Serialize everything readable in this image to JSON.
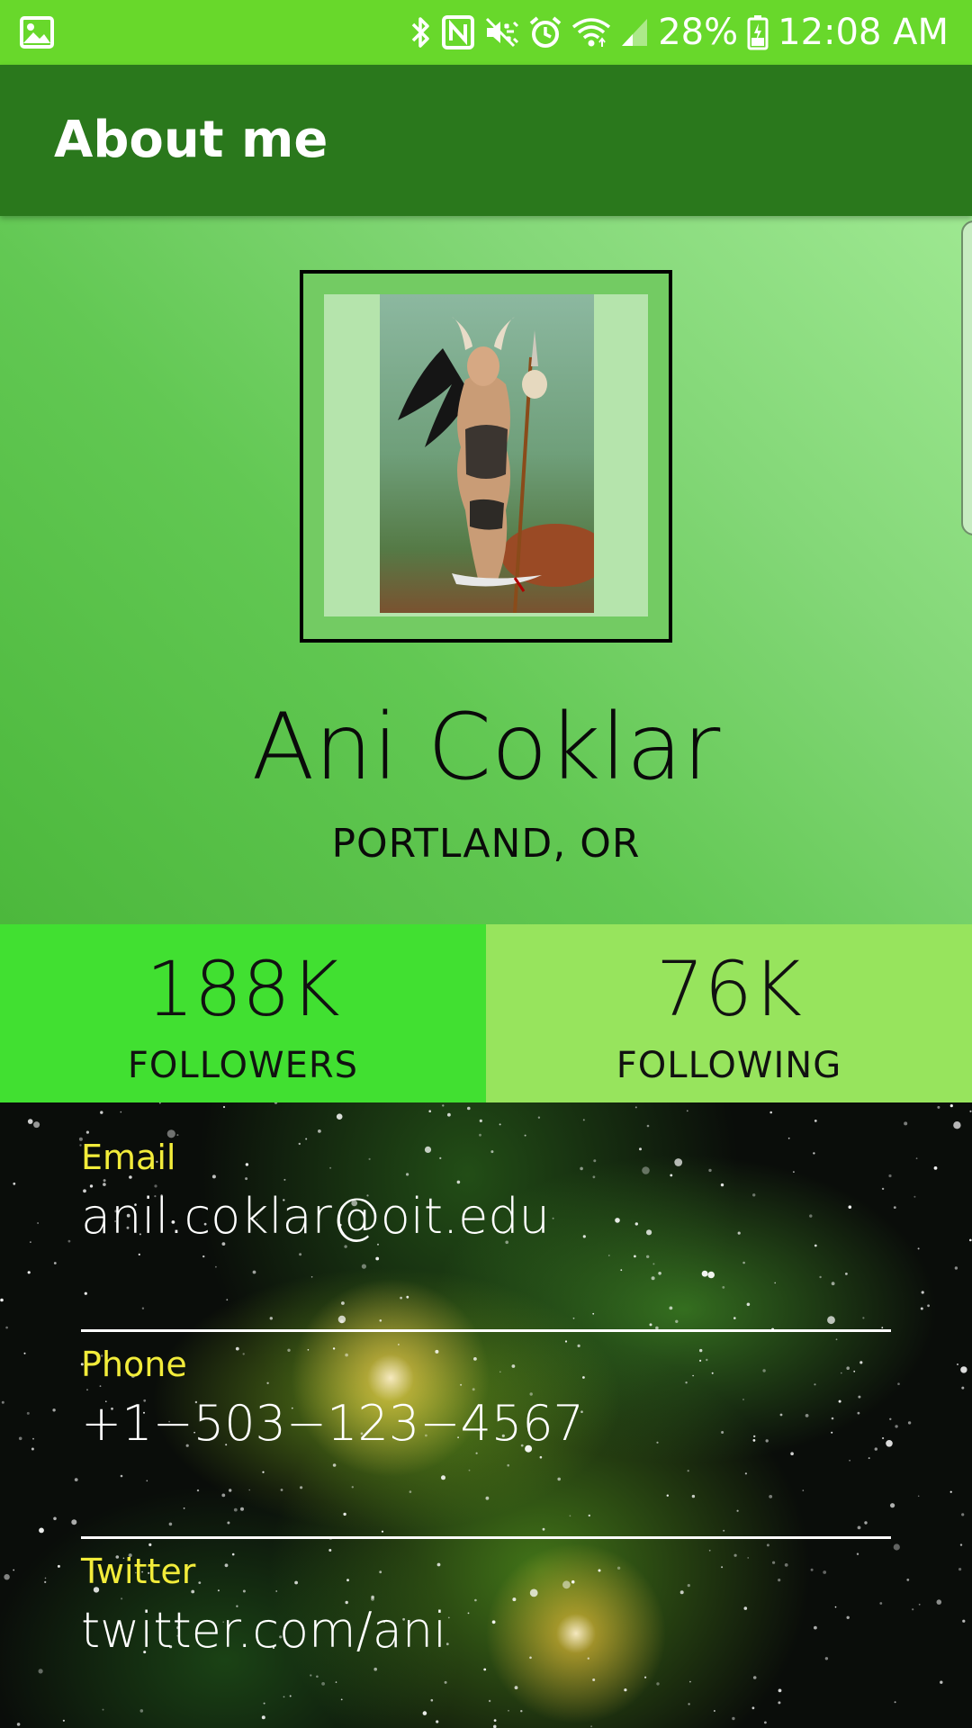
{
  "status_bar": {
    "battery": "28%",
    "time": "12:08 AM",
    "icons": [
      "image-icon",
      "bluetooth-icon",
      "nfc-icon",
      "mute-vibrate-icon",
      "alarm-icon",
      "wifi-icon",
      "signal-icon",
      "battery-icon"
    ]
  },
  "app_bar": {
    "title": "About me"
  },
  "profile": {
    "name": "Ani Coklar",
    "location": "PORTLAND, OR"
  },
  "stats": {
    "followers": {
      "value": "188K",
      "label": "FOLLOWERS"
    },
    "following": {
      "value": "76K",
      "label": "FOLLOWING"
    }
  },
  "contact": [
    {
      "label": "Email",
      "value": "anil.coklar@oit.edu"
    },
    {
      "label": "Phone",
      "value": "+1−503−123−4567"
    },
    {
      "label": "Twitter",
      "value": "twitter.com/ani"
    }
  ],
  "colors": {
    "status_bar": "#68d82b",
    "app_bar": "#2a781c",
    "followers_bg": "#41e031",
    "following_bg": "#97e45d",
    "field_label": "#f2ec3a"
  }
}
